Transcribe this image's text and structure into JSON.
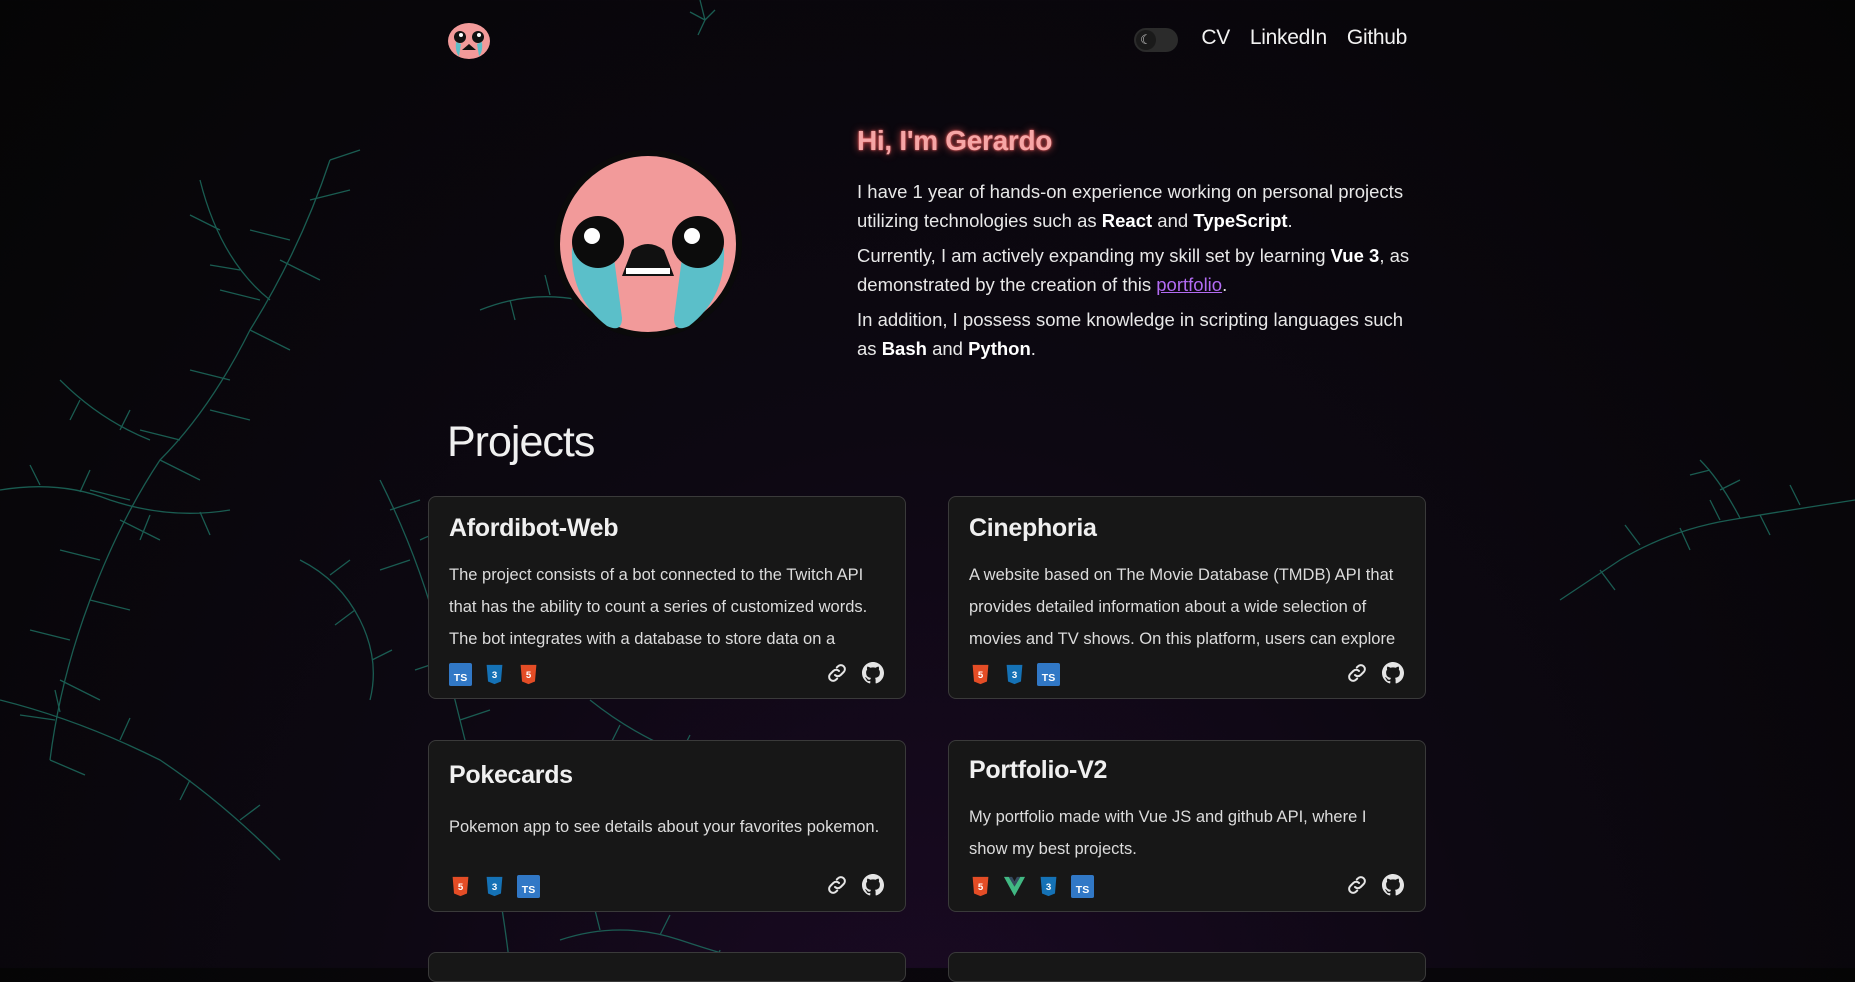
{
  "nav": {
    "logo": "isaac-face-logo",
    "theme_toggle": "moon-icon",
    "links": [
      "CV",
      "LinkedIn",
      "Github"
    ]
  },
  "hero": {
    "title": "Hi, I'm Gerardo",
    "p1": {
      "t1": "I have 1 year of hands-on experience working on personal projects utilizing technologies such as ",
      "b1": "React",
      "t2": " and ",
      "b2": "TypeScript",
      "t3": "."
    },
    "p2": {
      "t1": "Currently, I am actively expanding my skill set by learning ",
      "b1": "Vue 3",
      "t2": ", as demonstrated by the creation of this ",
      "link": "portfolio",
      "t3": "."
    },
    "p3": {
      "t1": "In addition, I possess some knowledge in scripting languages such as ",
      "b1": "Bash",
      "t2": " and ",
      "b2": "Python",
      "t3": "."
    }
  },
  "projects": {
    "title": "Projects",
    "items": [
      {
        "name": "Afordibot-Web",
        "description": "The project consists of a bot connected to the Twitch API that has the ability to count a series of customized words. The bot integrates with a database to store data on a weekly, monthly...",
        "tags": [
          "TS",
          "CSS3",
          "HTML5"
        ]
      },
      {
        "name": "Cinephoria",
        "description": "A website based on The Movie Database (TMDB) API that provides detailed information about a wide selection of movies and TV shows. On this platform, users can explore the movie...",
        "tags": [
          "HTML5",
          "CSS3",
          "TS"
        ]
      },
      {
        "name": "Pokecards",
        "description": "Pokemon app to see details about your favorites pokemon.",
        "tags": [
          "HTML5",
          "CSS3",
          "TS"
        ]
      },
      {
        "name": "Portfolio-V2",
        "description": "My portfolio made with Vue JS and github API, where I show my best projects.",
        "tags": [
          "HTML5",
          "Vue",
          "CSS3",
          "TS"
        ]
      }
    ]
  },
  "colors": {
    "accent_title": "#f6a6a6",
    "link": "#b26bf2",
    "html5": "#e44d26",
    "css3": "#1572b6",
    "ts": "#3178c6",
    "vue": "#41b883",
    "vines": "#1d6b5e"
  }
}
